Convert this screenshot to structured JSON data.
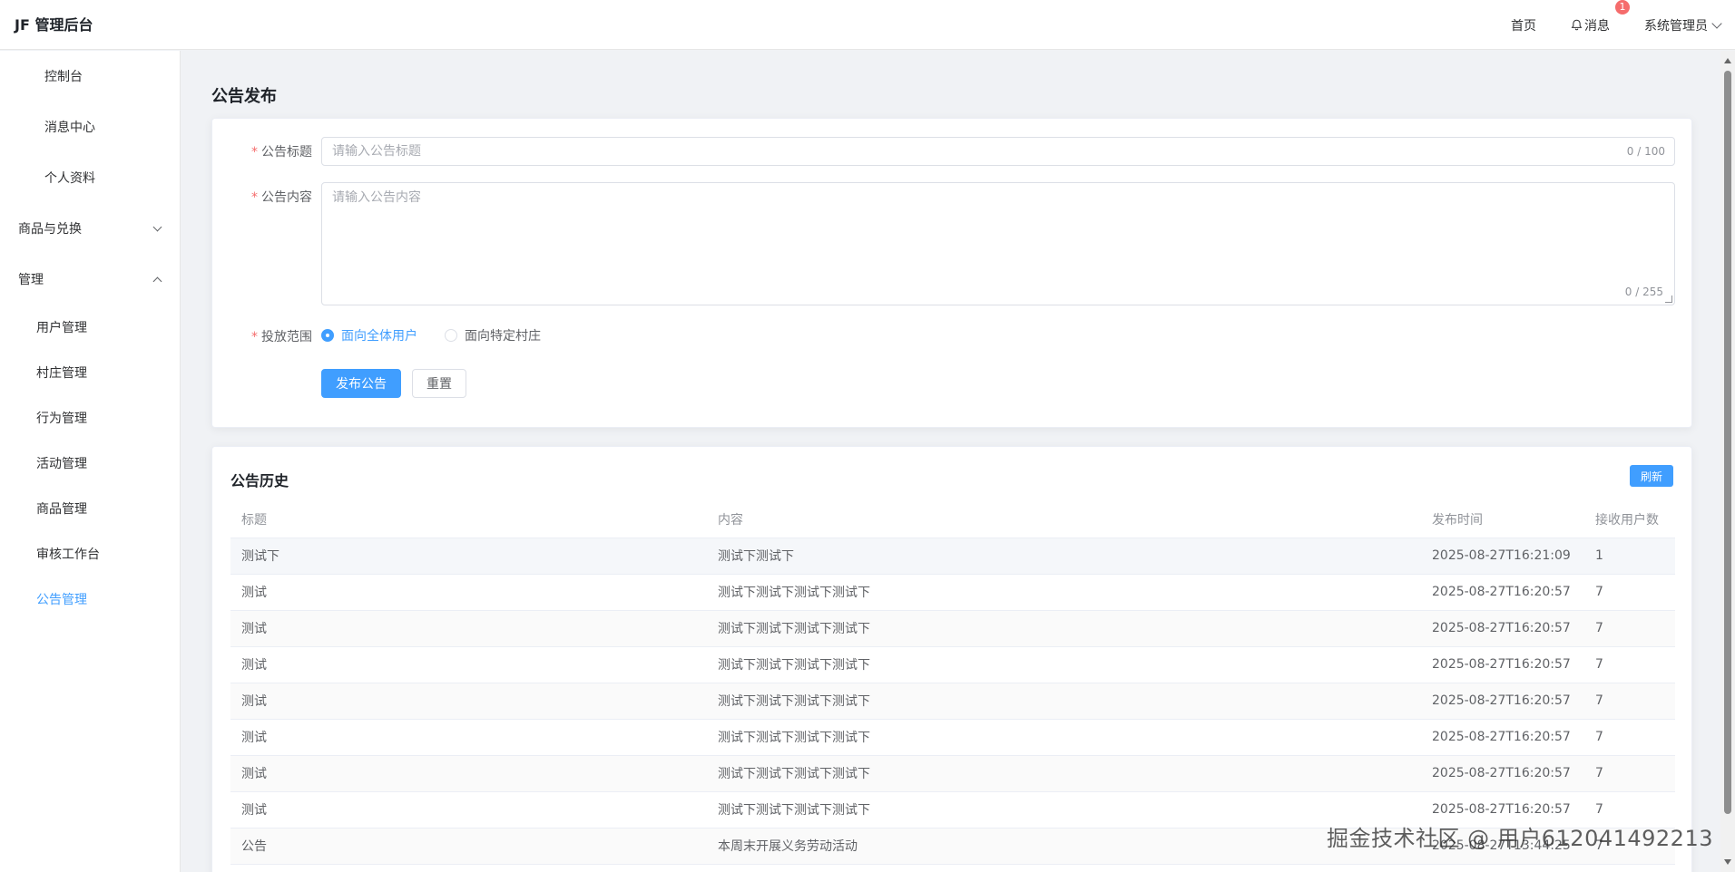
{
  "header": {
    "logo": "JF 管理后台",
    "home": "首页",
    "messages": "消息",
    "badge_count": "1",
    "user": "系统管理员"
  },
  "sidebar": {
    "top_items": [
      "控制台",
      "消息中心",
      "个人资料"
    ],
    "group_goods": "商品与兑换",
    "group_manage": "管理",
    "manage_items": [
      "用户管理",
      "村庄管理",
      "行为管理",
      "活动管理",
      "商品管理",
      "审核工作台",
      "公告管理"
    ],
    "active_item": "公告管理"
  },
  "page": {
    "title": "公告发布"
  },
  "form": {
    "title_label": "公告标题",
    "title_placeholder": "请输入公告标题",
    "title_count": "0 / 100",
    "content_label": "公告内容",
    "content_placeholder": "请输入公告内容",
    "content_count": "0 / 255",
    "scope_label": "投放范围",
    "scope_all": "面向全体用户",
    "scope_specific": "面向特定村庄",
    "submit": "发布公告",
    "reset": "重置",
    "required_mark": "*"
  },
  "history": {
    "title": "公告历史",
    "refresh": "刷新",
    "columns": [
      "标题",
      "内容",
      "发布时间",
      "接收用户数"
    ],
    "rows": [
      [
        "测试下",
        "测试下测试下",
        "2025-08-27T16:21:09",
        "1"
      ],
      [
        "测试",
        "测试下测试下测试下测试下",
        "2025-08-27T16:20:57",
        "7"
      ],
      [
        "测试",
        "测试下测试下测试下测试下",
        "2025-08-27T16:20:57",
        "7"
      ],
      [
        "测试",
        "测试下测试下测试下测试下",
        "2025-08-27T16:20:57",
        "7"
      ],
      [
        "测试",
        "测试下测试下测试下测试下",
        "2025-08-27T16:20:57",
        "7"
      ],
      [
        "测试",
        "测试下测试下测试下测试下",
        "2025-08-27T16:20:57",
        "7"
      ],
      [
        "测试",
        "测试下测试下测试下测试下",
        "2025-08-27T16:20:57",
        "7"
      ],
      [
        "测试",
        "测试下测试下测试下测试下",
        "2025-08-27T16:20:57",
        "7"
      ],
      [
        "公告",
        "本周末开展义务劳动活动",
        "2025-08-27T13:44:25",
        "7"
      ]
    ]
  },
  "watermark": "掘金技术社区 @ 用户612041492213",
  "colors": {
    "primary": "#409eff",
    "danger": "#f56c6c"
  }
}
